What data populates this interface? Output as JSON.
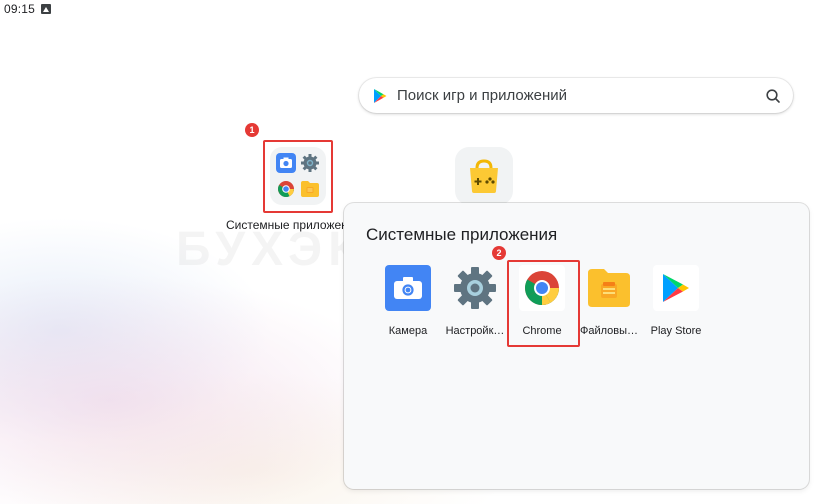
{
  "status_bar": {
    "time": "09:15",
    "notification_icon": "android-notification-icon"
  },
  "search": {
    "placeholder": "Поиск игр и приложений",
    "leading_icon": "play-store-icon",
    "trailing_icon": "search-icon"
  },
  "home": {
    "folder": {
      "label": "Системные приложения",
      "badge": "1",
      "preview_icons": [
        "camera-icon",
        "settings-gear-icon",
        "chrome-icon",
        "files-icon"
      ]
    },
    "games_app_icon": "games-bag-icon"
  },
  "folder_panel": {
    "title": "Системные приложения",
    "apps": [
      {
        "label": "Камера",
        "icon": "camera-icon"
      },
      {
        "label": "Настройк…",
        "icon": "settings-gear-icon"
      },
      {
        "label": "Chrome",
        "icon": "chrome-icon"
      },
      {
        "label": "Файловы…",
        "icon": "files-icon"
      },
      {
        "label": "Play Store",
        "icon": "play-store-icon"
      }
    ],
    "badge": "2"
  },
  "watermark": "БУХЭКСПЕРТ",
  "colors": {
    "highlight": "#e53935",
    "camera_blue": "#4285f4",
    "settings_gray": "#607d8b",
    "files_yellow": "#fbc02d"
  }
}
